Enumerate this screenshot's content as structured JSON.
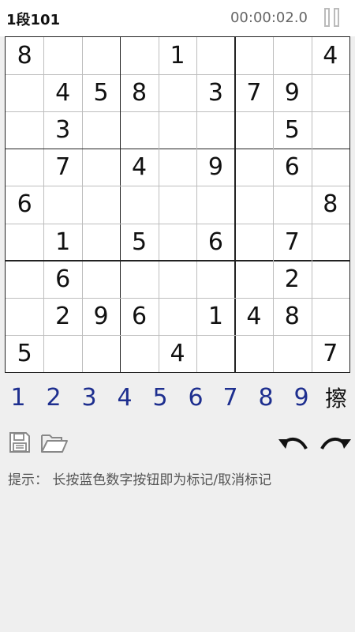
{
  "header": {
    "level_title": "1段101",
    "timer": "00:00:02.0"
  },
  "board": {
    "rows": [
      [
        "8",
        "",
        "",
        "",
        "1",
        "",
        "",
        "",
        "4"
      ],
      [
        "",
        "4",
        "5",
        "8",
        "",
        "3",
        "7",
        "9",
        ""
      ],
      [
        "",
        "3",
        "",
        "",
        "",
        "",
        "",
        "5",
        ""
      ],
      [
        "",
        "7",
        "",
        "4",
        "",
        "9",
        "",
        "6",
        ""
      ],
      [
        "6",
        "",
        "",
        "",
        "",
        "",
        "",
        "",
        "8"
      ],
      [
        "",
        "1",
        "",
        "5",
        "",
        "6",
        "",
        "7",
        ""
      ],
      [
        "",
        "6",
        "",
        "",
        "",
        "",
        "",
        "2",
        ""
      ],
      [
        "",
        "2",
        "9",
        "6",
        "",
        "1",
        "4",
        "8",
        ""
      ],
      [
        "5",
        "",
        "",
        "",
        "4",
        "",
        "",
        "",
        "7"
      ]
    ]
  },
  "numpad": {
    "digits": [
      "1",
      "2",
      "3",
      "4",
      "5",
      "6",
      "7",
      "8",
      "9"
    ],
    "erase_label": "擦"
  },
  "hint": {
    "text": "提示：  长按蓝色数字按钮即为标记/取消标记"
  },
  "colors": {
    "digit_button": "#1e2f8f",
    "background": "#efefef",
    "board_background": "#ffffff"
  }
}
